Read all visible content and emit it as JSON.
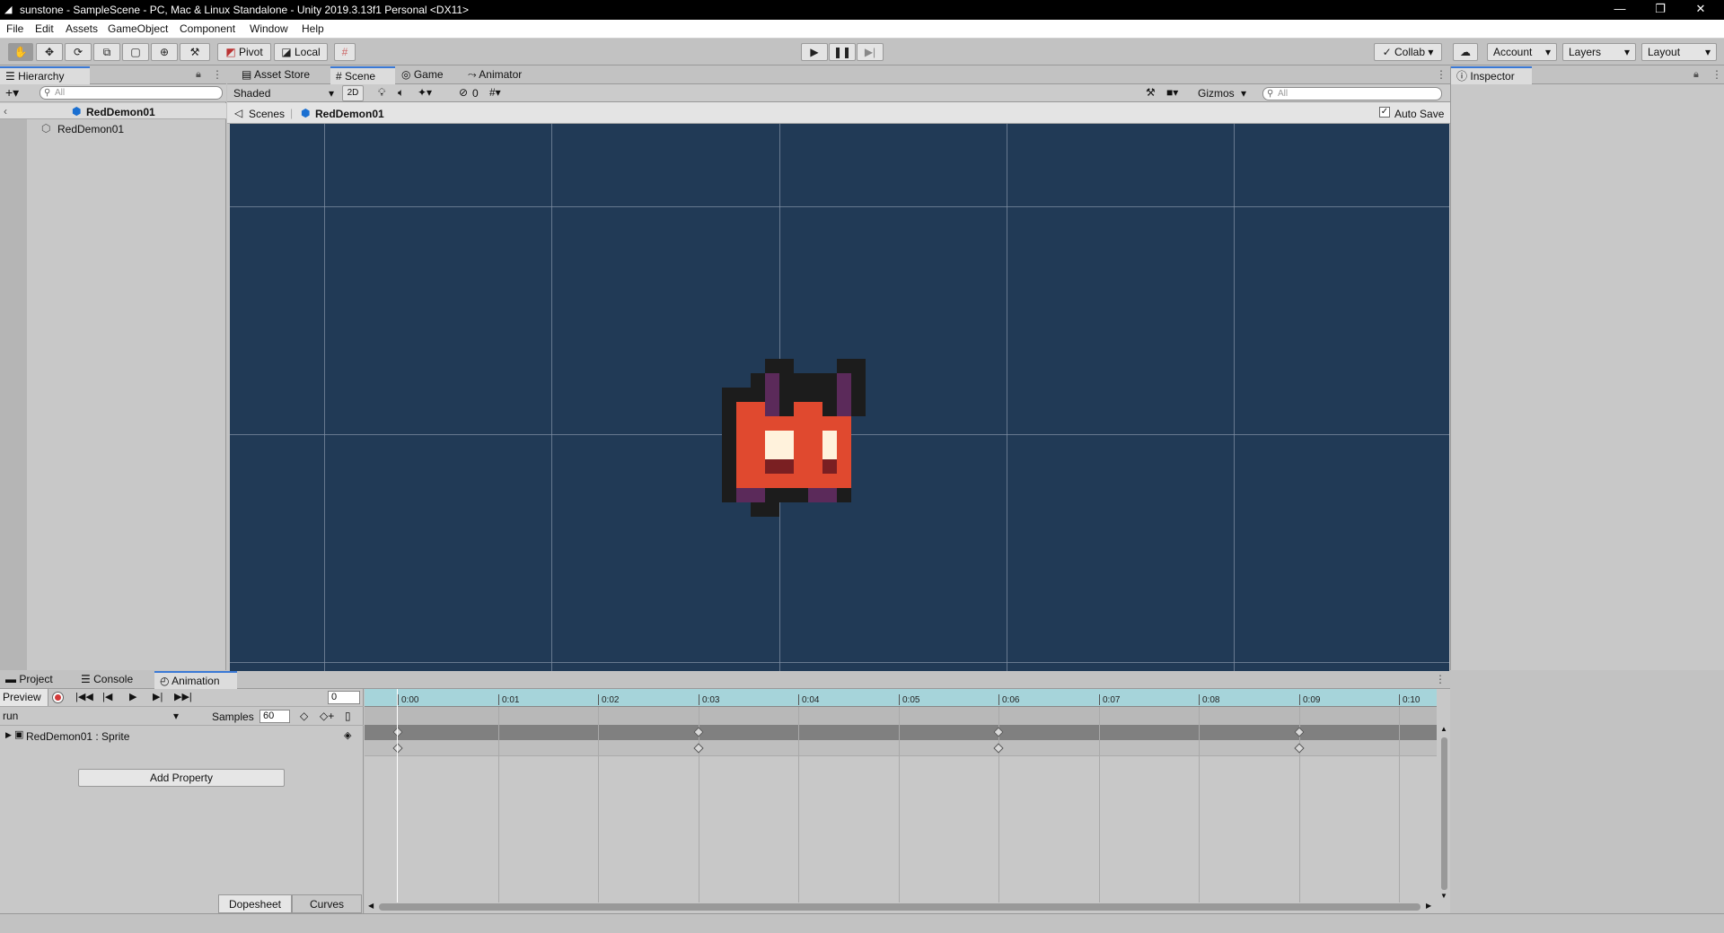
{
  "window": {
    "title": "sunstone - SampleScene - PC, Mac & Linux Standalone - Unity 2019.3.13f1 Personal <DX11>",
    "minimize": "—",
    "restore": "❐",
    "close": "✕"
  },
  "menu": [
    "File",
    "Edit",
    "Assets",
    "GameObject",
    "Component",
    "Window",
    "Help"
  ],
  "toolbar": {
    "pivot_label": "Pivot",
    "local_label": "Local",
    "collab_label": "Collab",
    "account_label": "Account",
    "layers_label": "Layers",
    "layout_label": "Layout"
  },
  "hierarchy": {
    "tab_label": "Hierarchy",
    "search_placeholder": "All",
    "scene_name": "RedDemon01",
    "items": [
      "RedDemon01"
    ]
  },
  "center_tabs": [
    "Asset Store",
    "Scene",
    "Game",
    "Animator"
  ],
  "scene_toolbar": {
    "shading_mode": "Shaded",
    "mode_2d": "2D",
    "hidden_count": "0",
    "gizmos_label": "Gizmos",
    "search_placeholder": "All"
  },
  "breadcrumb": {
    "root": "Scenes",
    "current": "RedDemon01",
    "auto_save_label": "Auto Save"
  },
  "inspector": {
    "tab_label": "Inspector"
  },
  "bottom_tabs": [
    "Project",
    "Console",
    "Animation"
  ],
  "animation": {
    "preview_label": "Preview",
    "frame_value": "0",
    "clip_name": "run",
    "samples_label": "Samples",
    "samples_value": "60",
    "property_name": "RedDemon01 : Sprite",
    "add_property_label": "Add Property",
    "timeline_labels": [
      "0:00",
      "0:01",
      "0:02",
      "0:03",
      "0:04",
      "0:05",
      "0:06",
      "0:07",
      "0:08",
      "0:09",
      "0:10"
    ],
    "keyframe_frames": [
      0,
      3,
      6,
      9
    ],
    "dopesheet_label": "Dopesheet",
    "curves_label": "Curves"
  },
  "colors": {
    "scene_bg": "#213a56",
    "accent": "#3a79d6",
    "timeline_header": "#a6d4da",
    "record_red": "#d43a3a"
  }
}
